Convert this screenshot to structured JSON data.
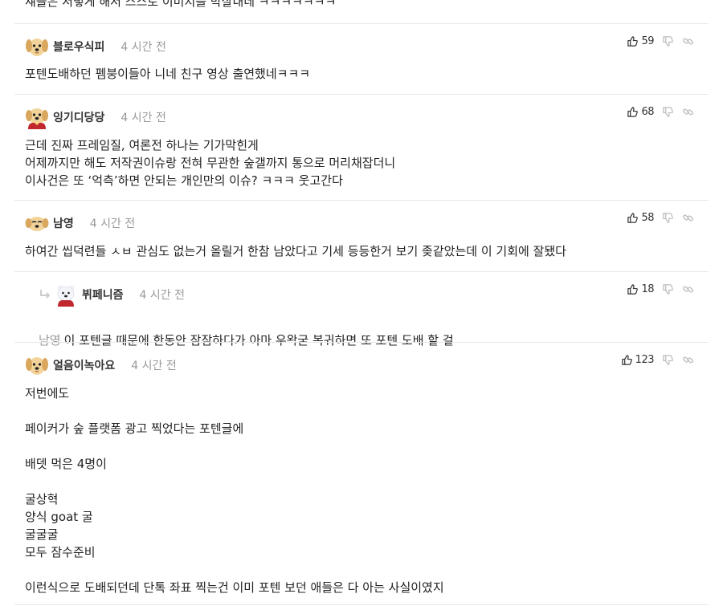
{
  "partial_top_text": "섀들은 서렇게 해서 스스로 이미지를 박살내네 ㅋㅋㅋㅋㅋㅋㅋ",
  "comments": [
    {
      "author": "블로우식피",
      "time": "4 시간 전",
      "likes": "59",
      "text": "포텐도배하던 펨붕이들아 니네 친구 영상 출연했네ㅋㅋㅋ"
    },
    {
      "author": "잉기디당당",
      "time": "4 시간 전",
      "likes": "68",
      "text": "근데 진짜 프레임질, 여론전 하나는 기가막힌게\n어제까지만 해도 저작권이슈랑 전혀 무관한 숲갤까지 통으로 머리채잡더니\n이사건은 또 ‘억측’하면 안되는 개인만의 이슈? ㅋㅋㅋ 웃고간다"
    },
    {
      "author": "남영",
      "time": "4 시간 전",
      "likes": "58",
      "text": "하여간 씹덕련들 ㅅㅂ 관심도 없는거 올릴거 한참 남았다고 기세 등등한거 보기 좆같았는데 이 기회에 잘됐다"
    },
    {
      "author": "뷔페니즘",
      "time": "4 시간 전",
      "likes": "18",
      "mention": "남영",
      "text": "이 포텐글 때문에 한동안 잠잠하다가 아마 우왁굳 복귀하면 또 포텐 도배 할 걸"
    },
    {
      "author": "얼음이녹아요",
      "time": "4 시간 전",
      "likes": "123",
      "text": "저번에도\n\n페이커가 숲 플랫폼 광고 찍었다는 포텐글에\n\n배뎃 먹은 4명이\n\n굴상혁\n양식 goat 굴\n굴굴굴\n모두 잠수준비\n\n이런식으로 도배되던데 단톡 좌표 찍는건 이미 포텐 보던 애들은 다 아는 사실이였지"
    }
  ],
  "icons": {
    "like": "thumbs-up-icon",
    "dislike": "thumbs-down-icon",
    "link": "link-icon",
    "reply_arrow": "reply-arrow-icon"
  }
}
